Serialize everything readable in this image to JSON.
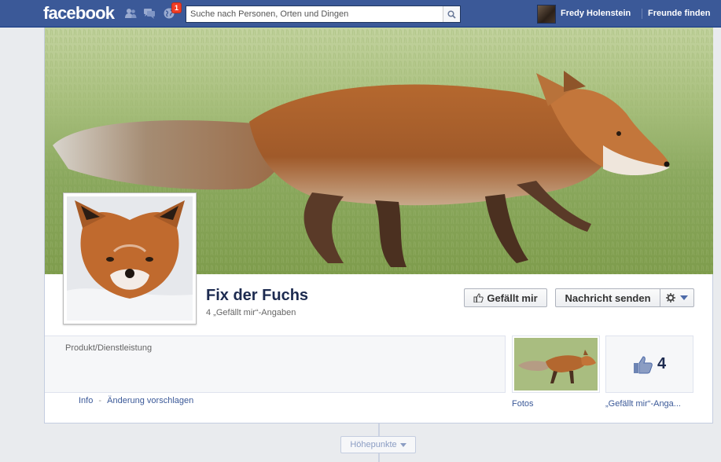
{
  "topbar": {
    "logo": "facebook",
    "notification_count": "1",
    "search_placeholder": "Suche nach Personen, Orten und Dingen",
    "user_name": "Fredy Holenstein",
    "friends_link": "Freunde finden"
  },
  "page": {
    "name": "Fix der Fuchs",
    "likes_summary": "4 „Gefällt mir“-Angaben",
    "category": "Produkt/Dienstleistung",
    "like_button": "Gefällt mir",
    "message_button": "Nachricht senden",
    "info_link": "Info",
    "suggest_link": "Änderung vorschlagen",
    "info_separator": "-"
  },
  "tiles": {
    "photos_label": "Fotos",
    "likes_value": "4",
    "likes_label": "„Gefällt mir“-Anga..."
  },
  "timeline": {
    "highlights_label": "Höhepunkte"
  },
  "colors": {
    "brand": "#3b5998",
    "badge": "#f03d25"
  },
  "icons": [
    "friend-requests-icon",
    "messages-icon",
    "notifications-globe-icon",
    "search-icon",
    "thumbs-up-icon",
    "gear-icon",
    "caret-down-icon"
  ]
}
